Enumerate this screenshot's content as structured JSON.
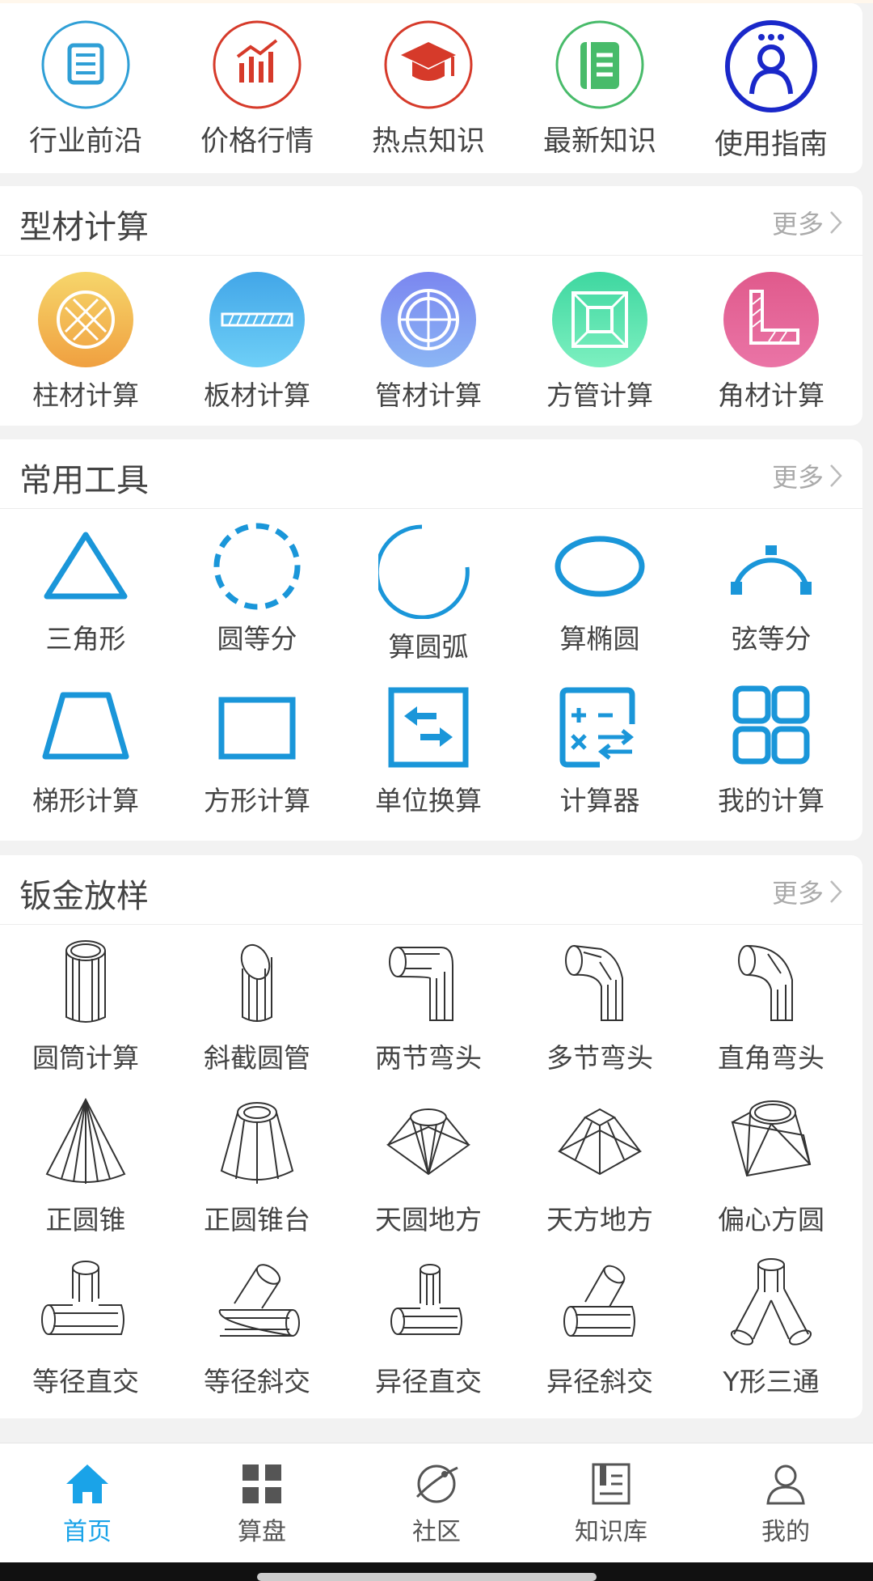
{
  "top": [
    {
      "label": "行业前沿",
      "icon": "news-icon",
      "color": "#2f9fd6"
    },
    {
      "label": "价格行情",
      "icon": "price-chart-icon",
      "color": "#d63a2a"
    },
    {
      "label": "热点知识",
      "icon": "graduation-cap-icon",
      "color": "#d63a2a"
    },
    {
      "label": "最新知识",
      "icon": "book-icon",
      "color": "#48bb6a"
    },
    {
      "label": "使用指南",
      "icon": "user-guide-icon",
      "color": "#1a28c9"
    }
  ],
  "profile": {
    "title": "型材计算",
    "more": "更多",
    "items": [
      {
        "label": "柱材计算",
        "icon": "round-bar-icon"
      },
      {
        "label": "板材计算",
        "icon": "plate-icon"
      },
      {
        "label": "管材计算",
        "icon": "pipe-icon"
      },
      {
        "label": "方管计算",
        "icon": "square-tube-icon"
      },
      {
        "label": "角材计算",
        "icon": "angle-steel-icon"
      }
    ]
  },
  "tools": {
    "title": "常用工具",
    "more": "更多",
    "items": [
      {
        "label": "三角形",
        "icon": "triangle-icon"
      },
      {
        "label": "圆等分",
        "icon": "circle-divide-icon"
      },
      {
        "label": "算圆弧",
        "icon": "arc-icon"
      },
      {
        "label": "算椭圆",
        "icon": "ellipse-icon"
      },
      {
        "label": "弦等分",
        "icon": "chord-divide-icon"
      },
      {
        "label": "梯形计算",
        "icon": "trapezoid-icon"
      },
      {
        "label": "方形计算",
        "icon": "rectangle-icon"
      },
      {
        "label": "单位换算",
        "icon": "unit-convert-icon"
      },
      {
        "label": "计算器",
        "icon": "calculator-icon"
      },
      {
        "label": "我的计算",
        "icon": "my-calc-grid-icon"
      }
    ]
  },
  "sheet": {
    "title": "钣金放样",
    "more": "更多",
    "items": [
      {
        "label": "圆筒计算",
        "icon": "cylinder-icon"
      },
      {
        "label": "斜截圆管",
        "icon": "oblique-pipe-icon"
      },
      {
        "label": "两节弯头",
        "icon": "two-section-elbow-icon"
      },
      {
        "label": "多节弯头",
        "icon": "multi-section-elbow-icon"
      },
      {
        "label": "直角弯头",
        "icon": "right-angle-elbow-icon"
      },
      {
        "label": "正圆锥",
        "icon": "cone-icon"
      },
      {
        "label": "正圆锥台",
        "icon": "frustum-icon"
      },
      {
        "label": "天圆地方",
        "icon": "round-to-square-icon"
      },
      {
        "label": "天方地方",
        "icon": "square-to-square-icon"
      },
      {
        "label": "偏心方圆",
        "icon": "eccentric-transition-icon"
      },
      {
        "label": "等径直交",
        "icon": "equal-tee-icon"
      },
      {
        "label": "等径斜交",
        "icon": "equal-oblique-tee-icon"
      },
      {
        "label": "异径直交",
        "icon": "reducing-tee-icon"
      },
      {
        "label": "异径斜交",
        "icon": "reducing-oblique-tee-icon"
      },
      {
        "label": "Y形三通",
        "icon": "y-tee-icon"
      }
    ]
  },
  "nav": [
    {
      "label": "首页",
      "icon": "home-icon",
      "active": true
    },
    {
      "label": "算盘",
      "icon": "grid-icon",
      "active": false
    },
    {
      "label": "社区",
      "icon": "planet-icon",
      "active": false
    },
    {
      "label": "知识库",
      "icon": "library-icon",
      "active": false
    },
    {
      "label": "我的",
      "icon": "person-icon",
      "active": false
    }
  ],
  "colors": {
    "accent": "#1aa3e8",
    "tool_blue": "#1a96d9"
  }
}
